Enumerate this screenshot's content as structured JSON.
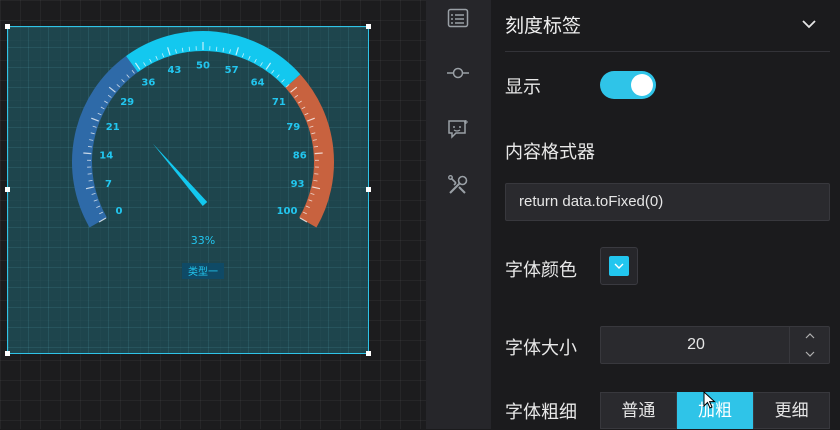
{
  "gauge": {
    "ticks": [
      "0",
      "7",
      "14",
      "21",
      "29",
      "36",
      "43",
      "50",
      "57",
      "64",
      "71",
      "79",
      "86",
      "93",
      "100"
    ],
    "value_percent": 33,
    "value_label": "33%",
    "series_badge": "类型一",
    "colors": {
      "low": "#2e6aa8",
      "mid": "#13c8ef",
      "high": "#c8623f",
      "label": "#22c6ef",
      "needle": "#13c8ef"
    }
  },
  "rail": {
    "icons": [
      "list-icon",
      "node-icon",
      "comment-icon",
      "tools-icon"
    ]
  },
  "panel": {
    "section_title": "刻度标签",
    "show_label": "显示",
    "show_enabled": true,
    "formatter_label": "内容格式器",
    "formatter_value": "return data.toFixed(0)",
    "font_color_label": "字体颜色",
    "font_color": "#22c6ef",
    "font_size_label": "字体大小",
    "font_size_value": "20",
    "font_weight_label": "字体粗细",
    "font_weight_options": [
      "普通",
      "加粗",
      "更细"
    ],
    "font_weight_selected": "加粗"
  }
}
